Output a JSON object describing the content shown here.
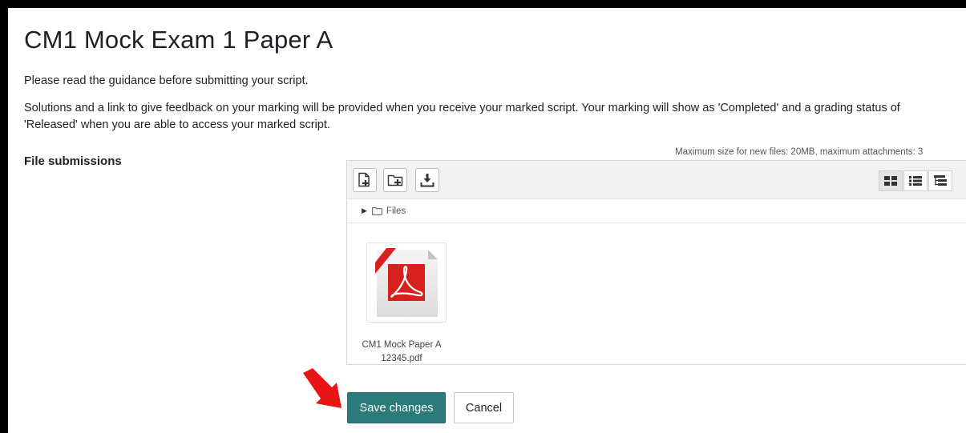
{
  "page": {
    "title": "CM1 Mock Exam 1 Paper A",
    "guidance": "Please read the guidance before submitting your script.",
    "info": "Solutions and a link to give feedback on your marking will be provided when you receive your marked script.  Your marking will show as 'Completed' and a grading status of 'Released' when you are able to access your marked script."
  },
  "file_submissions": {
    "label": "File submissions",
    "limits": "Maximum size for new files: 20MB, maximum attachments: 3",
    "toolbar": {
      "left_icons": [
        "add-file-icon",
        "create-folder-icon",
        "download-icon"
      ],
      "view_icons": [
        "icon-view-icon",
        "list-view-icon",
        "tree-view-icon"
      ],
      "active_view": "icon-view-icon"
    },
    "path": {
      "folder": "Files"
    },
    "files": [
      {
        "name": "CM1 Mock Paper A 12345.pdf",
        "icon": "pdf-icon"
      }
    ]
  },
  "actions": {
    "save_label": "Save changes",
    "cancel_label": "Cancel"
  },
  "colors": {
    "accent": "#2b7b7b",
    "annotation_arrow": "#e81313",
    "pdf_red": "#d6211e"
  }
}
